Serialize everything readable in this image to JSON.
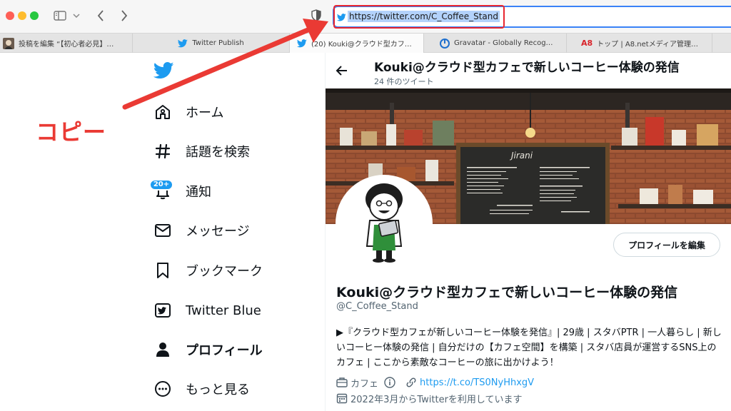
{
  "browser": {
    "url": "https://twitter.com/C_Coffee_Stand",
    "tabs": [
      {
        "label": "投稿を編集 “【初心者必見】…"
      },
      {
        "label": "Twitter Publish"
      },
      {
        "label": "(20) Kouki@クラウド型カフ…"
      },
      {
        "label": "Gravatar - Globally Recog…"
      },
      {
        "label": "トップ | A8.netメディア管理…"
      }
    ]
  },
  "annotation": {
    "text": "コピー"
  },
  "nav": {
    "items": [
      {
        "label": "ホーム",
        "icon": "home-icon"
      },
      {
        "label": "話題を検索",
        "icon": "hashtag-icon"
      },
      {
        "label": "通知",
        "icon": "bell-icon",
        "badge": "20+"
      },
      {
        "label": "メッセージ",
        "icon": "mail-icon"
      },
      {
        "label": "ブックマーク",
        "icon": "bookmark-icon"
      },
      {
        "label": "Twitter Blue",
        "icon": "twitter-blue-icon"
      },
      {
        "label": "プロフィール",
        "icon": "person-icon"
      },
      {
        "label": "もっと見る",
        "icon": "more-icon"
      }
    ]
  },
  "profile": {
    "header_name": "Kouki@クラウド型カフェで新しいコーヒー体験の発信",
    "tweet_count": "24 件のツイート",
    "name": "Kouki@クラウド型カフェで新しいコーヒー体験の発信",
    "handle": "@C_Coffee_Stand",
    "bio": "▶『クラウド型カフェが新しいコーヒー体験を発信』| 29歳 | スタバPTR | 一人暮らし | 新しいコーヒー体験の発信 | 自分だけの【カフェ空間】を構築 | スタバ店員が運営するSNS上のカフェ | ここから素敵なコーヒーの旅に出かけよう！",
    "category": "カフェ",
    "link": "https://t.co/TS0NyHhxgV",
    "joined": "2022年3月からTwitterを利用しています",
    "edit_button": "プロフィールを編集"
  },
  "colors": {
    "twitter_blue": "#1d9bf0",
    "annotation_red": "#ea3a34"
  }
}
